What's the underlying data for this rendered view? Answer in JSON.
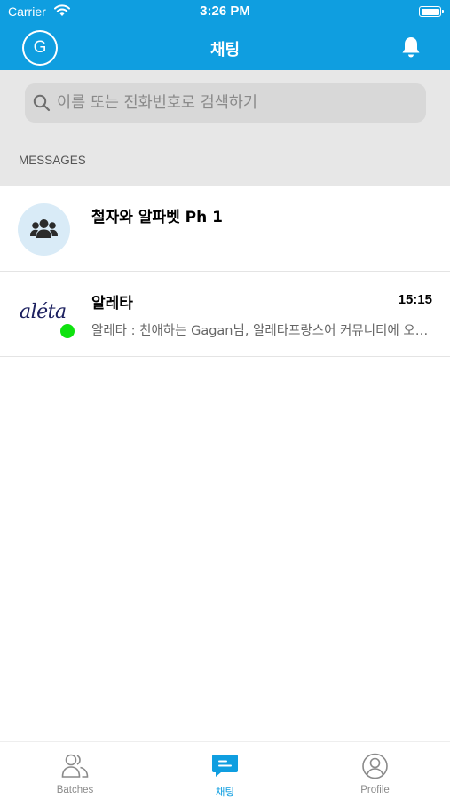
{
  "status_bar": {
    "carrier": "Carrier",
    "time": "3:26 PM"
  },
  "header": {
    "avatar_initial": "G",
    "title": "채팅",
    "bell_icon": "bell-icon"
  },
  "search": {
    "placeholder": "이름 또는 전화번호로 검색하기",
    "icon": "search-icon"
  },
  "section_label": "MESSAGES",
  "conversations": [
    {
      "title": "철자와 알파벳 Ph 1",
      "avatar": "group-icon",
      "time": "",
      "preview": ""
    },
    {
      "title": "알레타",
      "avatar_text": "aléta",
      "online": true,
      "time": "15:15",
      "preview": "알레타 : 친애하는 Gagan님, 알레타프랑스어 커뮤니티에 오신 것을 환영합니다"
    }
  ],
  "tabbar": {
    "tabs": [
      {
        "label": "Batches",
        "icon": "batches-icon",
        "active": false
      },
      {
        "label": "채팅",
        "icon": "chat-icon",
        "active": true
      },
      {
        "label": "Profile",
        "icon": "profile-icon",
        "active": false
      }
    ]
  },
  "colors": {
    "brand": "#0f9ee0",
    "online": "#0fe20f",
    "search_band": "#e7e7e7"
  }
}
